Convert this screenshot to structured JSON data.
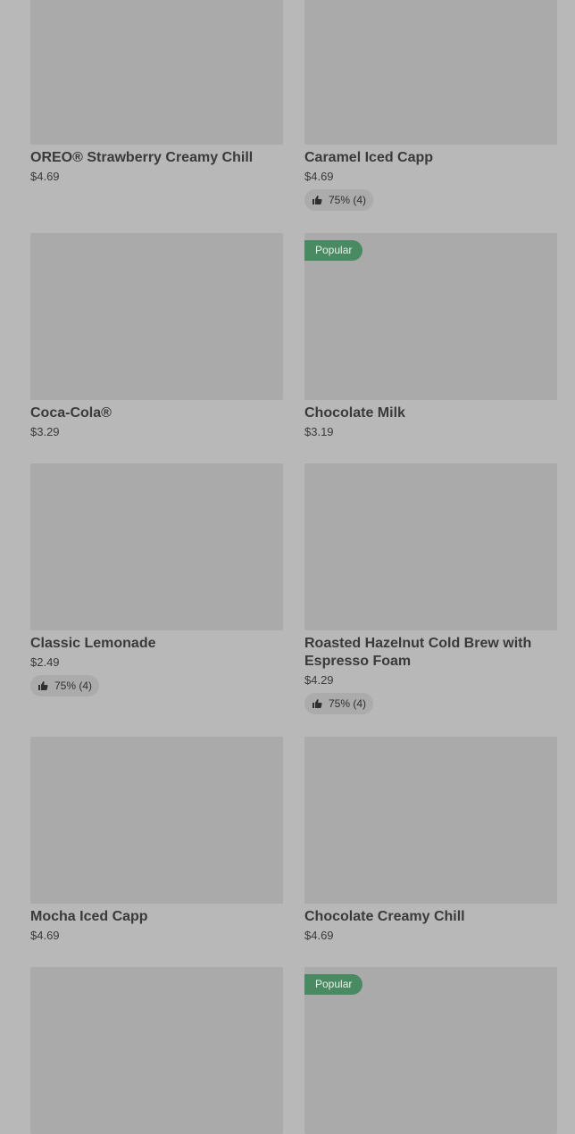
{
  "items": [
    {
      "name": "OREO® Strawberry Creamy Chill",
      "price": "$4.69",
      "badge": "",
      "rating": ""
    },
    {
      "name": "Caramel Iced Capp",
      "price": "$4.69",
      "badge": "",
      "rating": "75% (4)"
    },
    {
      "name": "Coca-Cola®",
      "price": "$3.29",
      "badge": "",
      "rating": ""
    },
    {
      "name": "Chocolate Milk",
      "price": "$3.19",
      "badge": "Popular",
      "rating": ""
    },
    {
      "name": "Classic Lemonade",
      "price": "$2.49",
      "badge": "",
      "rating": "75% (4)"
    },
    {
      "name": "Roasted Hazelnut Cold Brew with Espresso Foam",
      "price": "$4.29",
      "badge": "",
      "rating": "75% (4)"
    },
    {
      "name": "Mocha Iced Capp",
      "price": "$4.69",
      "badge": "",
      "rating": ""
    },
    {
      "name": "Chocolate Creamy Chill",
      "price": "$4.69",
      "badge": "",
      "rating": ""
    },
    {
      "name": "",
      "price": "",
      "badge": "",
      "rating": ""
    },
    {
      "name": "",
      "price": "",
      "badge": "Popular",
      "rating": ""
    }
  ],
  "colors": {
    "background": "#b8b8b8",
    "image_placeholder": "#aaaaaa",
    "popular_badge": "#4a8a63",
    "rating_pill": "#ababab"
  },
  "icons": {
    "rating": "thumbs-up-icon"
  }
}
